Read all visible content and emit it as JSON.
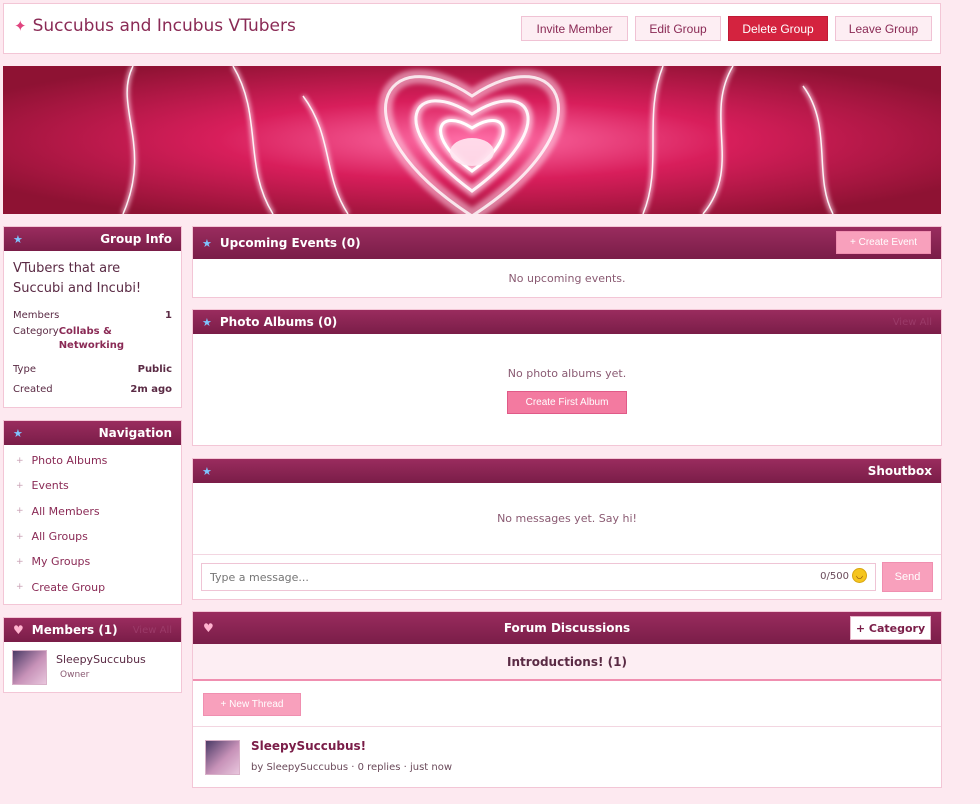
{
  "group": {
    "title": "Succubus and Incubus VTubers",
    "invite_label": "Invite Member",
    "edit_label": "Edit Group",
    "delete_label": "Delete Group",
    "leave_label": "Leave Group"
  },
  "info": {
    "header": "Group Info",
    "description": "VTubers that are Succubi and Incubi!",
    "members_label": "Members",
    "members_value": "1",
    "category_label": "Category",
    "category_value": "Collabs & Networking",
    "type_label": "Type",
    "type_value": "Public",
    "created_label": "Created",
    "created_value": "2m ago"
  },
  "navigation": {
    "header": "Navigation",
    "items": [
      {
        "label": "Photo Albums"
      },
      {
        "label": "Events"
      },
      {
        "label": "All Members"
      },
      {
        "label": "All Groups"
      },
      {
        "label": "My Groups"
      },
      {
        "label": "Create Group"
      }
    ]
  },
  "members": {
    "header": "Members (1)",
    "view_all": "View All",
    "list": [
      {
        "name": "SleepySuccubus",
        "role": "Owner"
      }
    ]
  },
  "events": {
    "header": "Upcoming Events (0)",
    "create_label": "+ Create Event",
    "empty": "No upcoming events."
  },
  "albums": {
    "header": "Photo Albums (0)",
    "view_all": "View All",
    "empty": "No photo albums yet.",
    "create_label": "Create First Album"
  },
  "shoutbox": {
    "header": "Shoutbox",
    "empty": "No messages yet. Say hi!",
    "placeholder": "Type a message...",
    "counter": "0/500",
    "send_label": "Send"
  },
  "forum": {
    "header": "Forum Discussions",
    "category_button": "+ Category",
    "category_title": "Introductions! (1)",
    "new_thread_label": "+ New Thread",
    "threads": [
      {
        "title": "SleepySuccubus!",
        "meta": "by SleepySuccubus · 0 replies · just now"
      }
    ]
  },
  "colors": {
    "accent": "#8a2a55",
    "header": "#7a1d48",
    "danger": "#d4233f",
    "pink_button": "#f37aa0",
    "background": "#fde9f0"
  }
}
